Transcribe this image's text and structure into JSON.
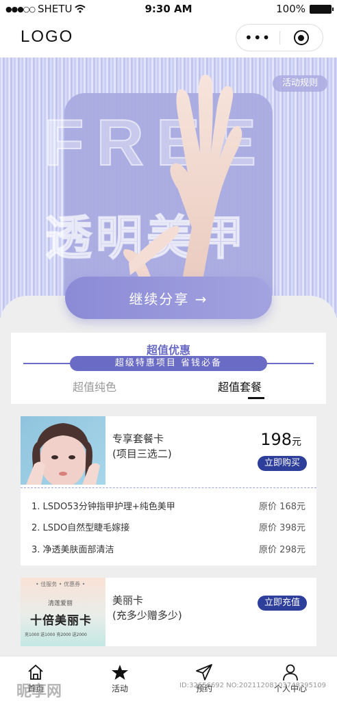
{
  "status_bar": {
    "carrier": "SHETU",
    "time": "9:30 AM",
    "battery": "100%"
  },
  "header": {
    "logo": "LOGO",
    "more_glyph": "•••"
  },
  "banner": {
    "rules_button": "活动规则",
    "bg_text_en": "FREE",
    "bg_text_cn": "透明美甲",
    "share_button": "继续分享 →"
  },
  "deals": {
    "title": "超值优惠",
    "subtitle": "超级特惠项目 省钱必备",
    "tabs": [
      "超值纯色",
      "超值套餐"
    ],
    "active_tab": "超值套餐"
  },
  "package_card": {
    "name_line1": "专享套餐卡",
    "name_line2": "(项目三选二)",
    "price": "198",
    "price_unit": "元",
    "buy_button": "立即购买",
    "items": [
      {
        "label": "1. LSDO53分钟指甲护理+纯色美甲",
        "price": "原价 168元"
      },
      {
        "label": "2. LSDO自然型睫毛嫁接",
        "price": "原价 398元"
      },
      {
        "label": "3. 净透美肤面部清洁",
        "price": "原价 298元"
      }
    ]
  },
  "beauty_card": {
    "name_line1": "美丽卡",
    "name_line2": "(充多少赠多少)",
    "recharge_button": "立即充值",
    "image_tag": "• 佳服务 • 优惠券 •",
    "image_sub": "清莲爱丽",
    "image_title": "十倍美丽卡",
    "image_tiny": "充1000 送1000 充2000 送2000"
  },
  "tabbar": {
    "items": [
      {
        "label": "首页",
        "icon": "home-icon"
      },
      {
        "label": "活动",
        "icon": "star-icon"
      },
      {
        "label": "预约",
        "icon": "send-icon"
      },
      {
        "label": "个人中心",
        "icon": "user-icon"
      }
    ]
  },
  "watermark": {
    "brand": "昵享网",
    "id": "ID:32656692 NO:20211208103748295109"
  }
}
